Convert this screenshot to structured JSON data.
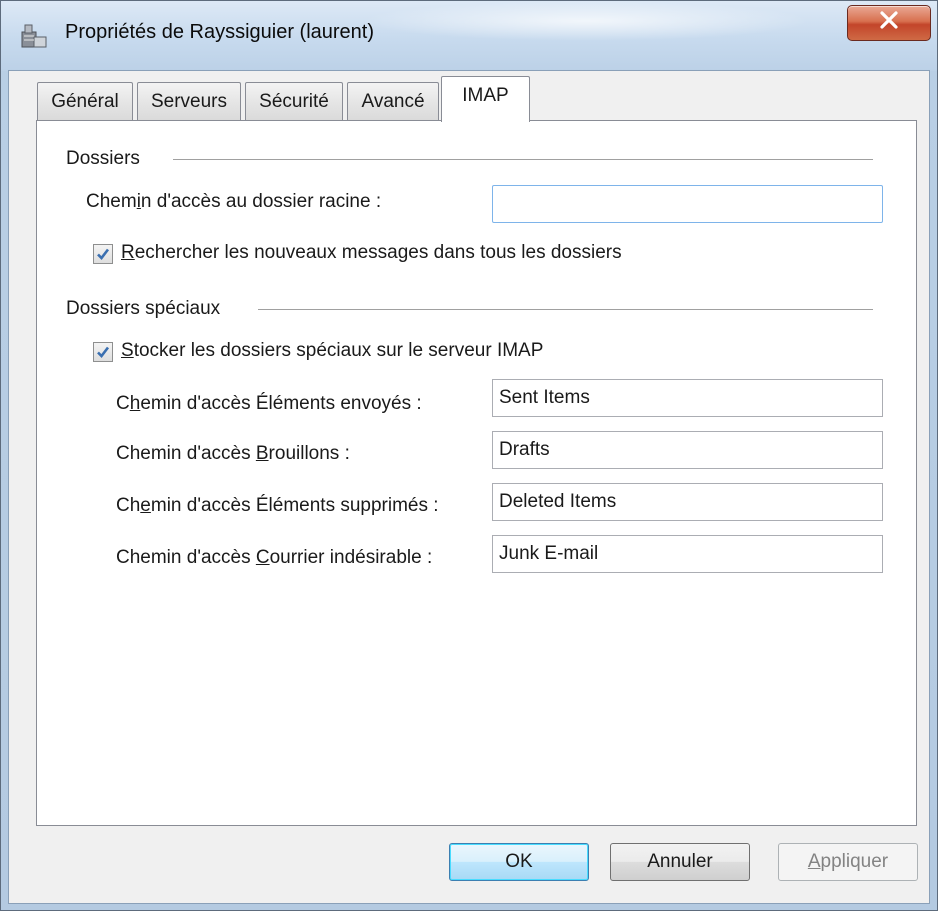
{
  "window": {
    "title": "Propriétés de Rayssiguier (laurent)",
    "close_icon": "close-icon"
  },
  "tabs": [
    {
      "label": "Général",
      "active": false
    },
    {
      "label": "Serveurs",
      "active": false
    },
    {
      "label": "Sécurité",
      "active": false
    },
    {
      "label": "Avancé",
      "active": false
    },
    {
      "label": "IMAP",
      "active": true
    }
  ],
  "dossiers": {
    "group_label": "Dossiers",
    "root_path_label_pre": "Chem",
    "root_path_label_ul": "i",
    "root_path_label_post": "n d'accès au dossier racine :",
    "root_path_value": "",
    "search_all_checked": true,
    "search_all_label_ul": "R",
    "search_all_label_post": "echercher les nouveaux messages dans tous les dossiers"
  },
  "special": {
    "group_label": "Dossiers spéciaux",
    "store_checked": true,
    "store_label_ul": "S",
    "store_label_post": "tocker les dossiers spéciaux sur le serveur IMAP",
    "sent_label_pre": "C",
    "sent_label_ul": "h",
    "sent_label_post": "emin d'accès Éléments envoyés :",
    "sent_value": "Sent Items",
    "drafts_label_pre": "Chemin d'accès ",
    "drafts_label_ul": "B",
    "drafts_label_post": "rouillons :",
    "drafts_value": "Drafts",
    "deleted_label_pre": "Ch",
    "deleted_label_ul": "e",
    "deleted_label_post": "min d'accès Éléments supprimés :",
    "deleted_value": "Deleted Items",
    "junk_label_pre": "Chemin d'accès ",
    "junk_label_ul": "C",
    "junk_label_post": "ourrier indésirable :",
    "junk_value": "Junk E-mail"
  },
  "buttons": {
    "ok": "OK",
    "cancel": "Annuler",
    "apply_ul": "A",
    "apply_post": "ppliquer"
  },
  "colors": {
    "close_button": "#c3452a",
    "default_button_border": "#3c7fb1",
    "focus_border": "#7eb4ea"
  }
}
